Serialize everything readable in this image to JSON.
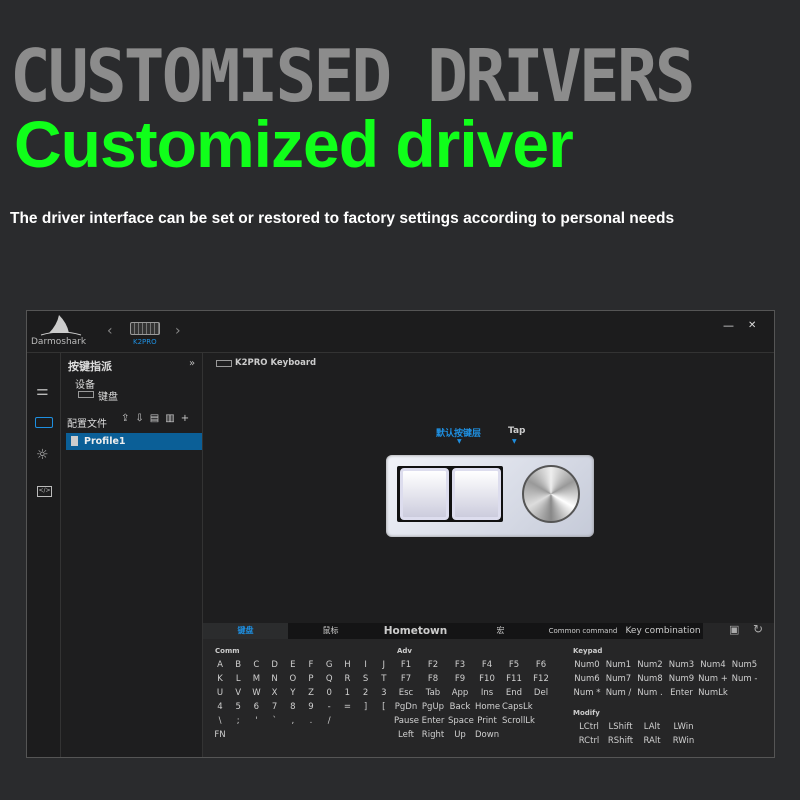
{
  "headline": "CUSTOMISED DRIVERS",
  "subheadline": "Customized driver",
  "description": "The driver interface can be set or restored to factory settings according to personal needs",
  "app": {
    "brand": "Darmoshark",
    "device_name": "K2PRO",
    "window_controls": {
      "minimize": "—",
      "close": "✕"
    },
    "left_panel": {
      "title": "按键指派",
      "collapse": "»",
      "device_label": "设备",
      "device_item": "键盘",
      "profiles_label": "配置文件",
      "profiles": [
        "Profile1"
      ]
    },
    "main": {
      "device_title": "K2PRO Keyboard",
      "layer_label": "默认按键层",
      "tap_label": "Tap"
    },
    "bottom": {
      "tabs": [
        "键盘",
        "鼠标",
        "Hometown",
        "宏",
        "Common command",
        "Key combination"
      ],
      "comm": {
        "title": "Comm",
        "rows": [
          [
            "A",
            "B",
            "C",
            "D",
            "E",
            "F",
            "G",
            "H",
            "I",
            "J"
          ],
          [
            "K",
            "L",
            "M",
            "N",
            "O",
            "P",
            "Q",
            "R",
            "S",
            "T"
          ],
          [
            "U",
            "V",
            "W",
            "X",
            "Y",
            "Z",
            "0",
            "1",
            "2",
            "3"
          ],
          [
            "4",
            "5",
            "6",
            "7",
            "8",
            "9",
            "-",
            "=",
            "]",
            "["
          ],
          [
            "\\",
            ";",
            "'",
            "`",
            ",",
            ".",
            "/"
          ],
          [
            "FN"
          ]
        ]
      },
      "adv": {
        "title": "Adv",
        "rows": [
          [
            "F1",
            "F2",
            "F3",
            "F4",
            "F5",
            "F6"
          ],
          [
            "F7",
            "F8",
            "F9",
            "F10",
            "F11",
            "F12"
          ],
          [
            "Esc",
            "Tab",
            "App",
            "Ins",
            "End",
            "Del"
          ],
          [
            "PgDn",
            "PgUp",
            "Back",
            "Home",
            "CapsLk"
          ],
          [
            "Pause",
            "Enter",
            "Space",
            "Print",
            "ScrollLk"
          ],
          [
            "Left",
            "Right",
            "Up",
            "Down"
          ]
        ]
      },
      "keypad": {
        "title": "Keypad",
        "rows": [
          [
            "Num0",
            "Num1",
            "Num2",
            "Num3",
            "Num4",
            "Num5"
          ],
          [
            "Num6",
            "Num7",
            "Num8",
            "Num9",
            "Num +",
            "Num -"
          ],
          [
            "Num *",
            "Num /",
            "Num .",
            "Enter",
            "NumLk"
          ]
        ]
      },
      "modify": {
        "title": "Modify",
        "rows": [
          [
            "LCtrl",
            "LShift",
            "LAlt",
            "LWin"
          ],
          [
            "RCtrl",
            "RShift",
            "RAlt",
            "RWin"
          ]
        ]
      }
    }
  }
}
